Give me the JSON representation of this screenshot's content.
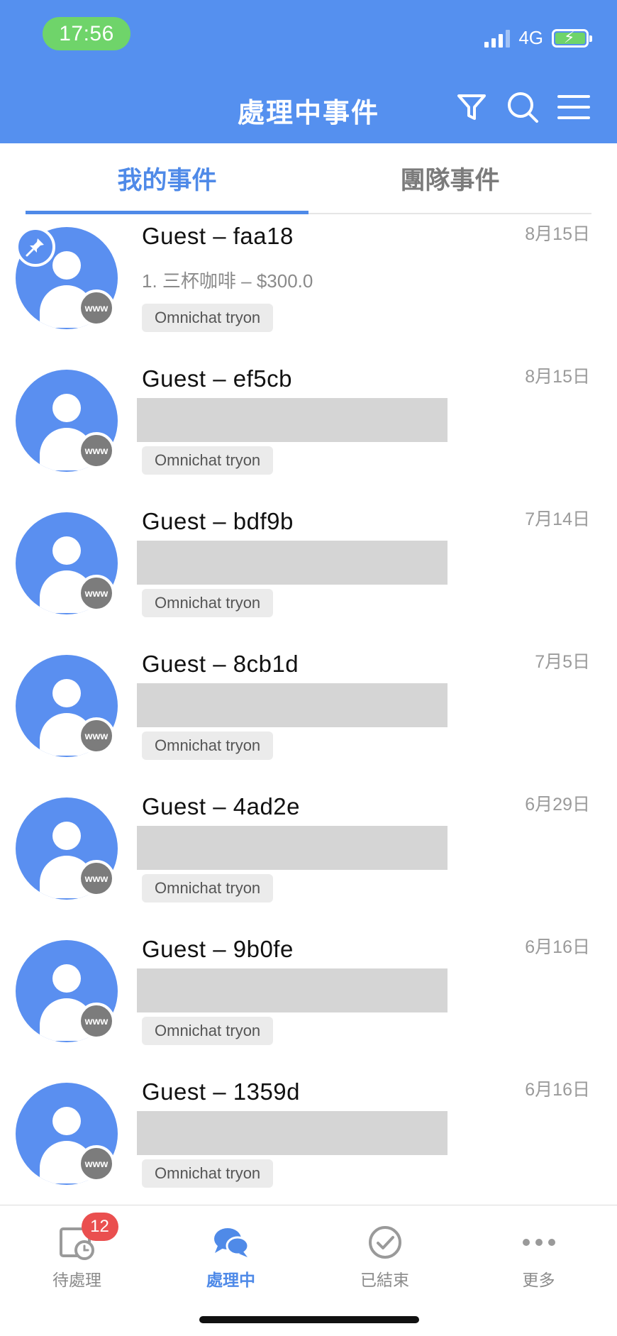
{
  "status_bar": {
    "time": "17:56",
    "network": "4G"
  },
  "header": {
    "title": "處理中事件"
  },
  "tabs": [
    {
      "label": "我的事件",
      "active": true
    },
    {
      "label": "團隊事件",
      "active": false
    }
  ],
  "conversations": [
    {
      "name": "Guest – faa18",
      "date": "8月15日",
      "preview": "1. 三杯咖啡 – $300.0",
      "channel_badge": "www",
      "tag": "Omnichat tryon",
      "pinned": true
    },
    {
      "name": "Guest – ef5cb",
      "date": "8月15日",
      "channel_badge": "www",
      "tag": "Omnichat tryon"
    },
    {
      "name": "Guest – bdf9b",
      "date": "7月14日",
      "channel_badge": "www",
      "tag": "Omnichat tryon"
    },
    {
      "name": "Guest – 8cb1d",
      "date": "7月5日",
      "channel_badge": "www",
      "tag": "Omnichat tryon"
    },
    {
      "name": "Guest – 4ad2e",
      "date": "6月29日",
      "channel_badge": "www",
      "tag": "Omnichat tryon"
    },
    {
      "name": "Guest – 9b0fe",
      "date": "6月16日",
      "channel_badge": "www",
      "tag": "Omnichat tryon"
    },
    {
      "name": "Guest – 1359d",
      "date": "6月16日",
      "channel_badge": "www",
      "tag": "Omnichat tryon"
    }
  ],
  "bottom_nav": [
    {
      "label": "待處理",
      "badge": "12",
      "icon": "clock-calendar-icon"
    },
    {
      "label": "處理中",
      "icon": "chat-bubbles-icon",
      "active": true
    },
    {
      "label": "已結束",
      "icon": "check-circle-icon"
    },
    {
      "label": "更多",
      "icon": "more-dots-icon"
    }
  ],
  "colors": {
    "primary": "#5590ef",
    "accent": "#4f8ae8",
    "badge_red": "#ea4f4f",
    "status_green": "#6fd46a"
  }
}
